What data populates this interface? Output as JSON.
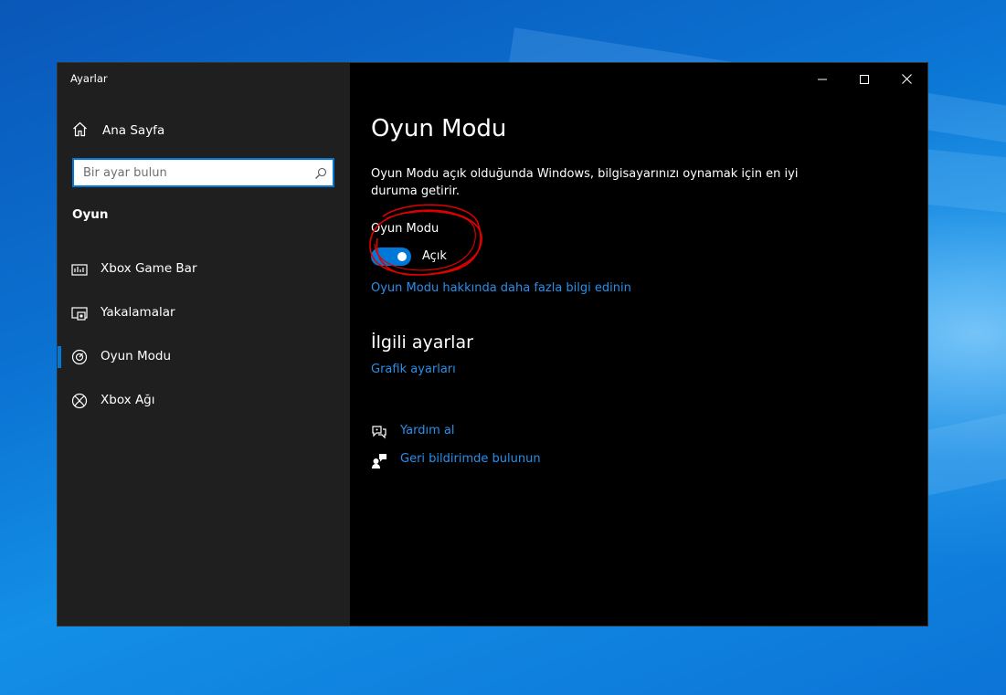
{
  "window": {
    "app_title": "Ayarlar",
    "controls": {
      "minimize": "minimize-icon",
      "maximize": "maximize-icon",
      "close": "close-icon"
    }
  },
  "sidebar": {
    "home_label": "Ana Sayfa",
    "search_placeholder": "Bir ayar bulun",
    "section_label": "Oyun",
    "items": [
      {
        "label": "Xbox Game Bar",
        "icon": "game-bar-icon",
        "selected": false
      },
      {
        "label": "Yakalamalar",
        "icon": "captures-icon",
        "selected": false
      },
      {
        "label": "Oyun Modu",
        "icon": "game-mode-icon",
        "selected": true
      },
      {
        "label": "Xbox Ağı",
        "icon": "xbox-icon",
        "selected": false
      }
    ]
  },
  "main": {
    "title": "Oyun Modu",
    "description": "Oyun Modu açık olduğunda Windows, bilgisayarınızı oynamak için en iyi duruma getirir.",
    "toggle": {
      "label": "Oyun Modu",
      "state_text": "Açık",
      "on": true
    },
    "learn_more_link": "Oyun Modu hakkında daha fazla bilgi edinin",
    "related_title": "İlgili ayarlar",
    "related_links": [
      "Grafik ayarları"
    ],
    "help_links": [
      {
        "label": "Yardım al",
        "icon": "help-chat-icon"
      },
      {
        "label": "Geri bildirimde bulunun",
        "icon": "feedback-icon"
      }
    ]
  },
  "colors": {
    "accent": "#0078d7",
    "link": "#2a8fe8",
    "sidebar_bg": "#1f1f1f",
    "content_bg": "#000000",
    "annotation": "#e00000"
  }
}
